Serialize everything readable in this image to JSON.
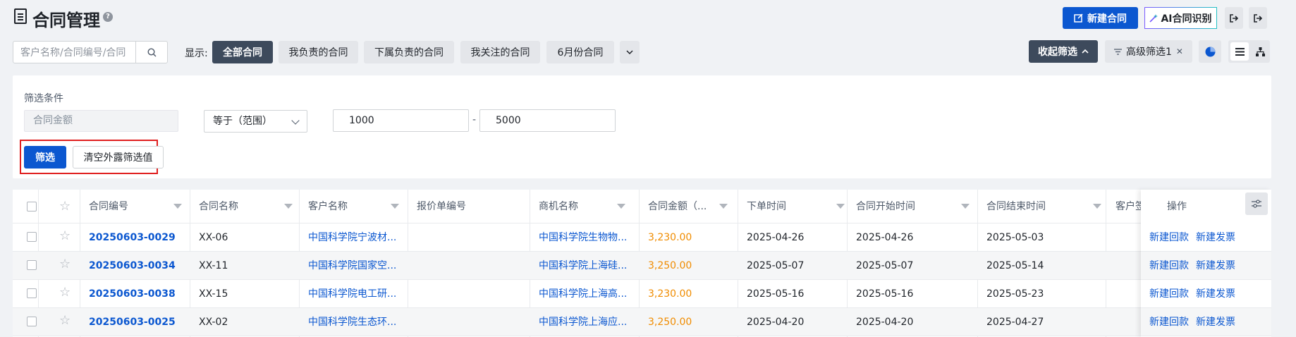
{
  "header": {
    "title": "合同管理",
    "help_glyph": "?",
    "new_contract": "新建合同",
    "ai_recognize": "AI合同识别"
  },
  "toolbar": {
    "search_placeholder": "客户名称/合同编号/合同",
    "show_label": "显示:",
    "views": [
      "全部合同",
      "我负责的合同",
      "下属负责的合同",
      "我关注的合同",
      "6月份合同"
    ],
    "active_view": 0,
    "collapse_filter": "收起筛选",
    "advanced_filter": "高级筛选1"
  },
  "filter": {
    "section_label": "筛选条件",
    "field": "合同金额",
    "operator": "等于（范围）",
    "min": "1000",
    "max": "5000",
    "range_sep": "-",
    "apply": "筛选",
    "clear": "清空外露筛选值"
  },
  "table": {
    "columns": [
      "合同编号",
      "合同名称",
      "客户名称",
      "报价单编号",
      "商机名称",
      "合同金额（...",
      "下单时间",
      "合同开始时间",
      "合同结束时间",
      "客户签"
    ],
    "ops_header": "操作",
    "rows": [
      {
        "id": "20250603-0029",
        "name": "XX-06",
        "customer": "中国科学院宁波材...",
        "quote": "",
        "opportunity": "中国科学院生物物...",
        "amount": "3,230.00",
        "order_date": "2025-04-26",
        "start": "2025-04-26",
        "end": "2025-05-03"
      },
      {
        "id": "20250603-0034",
        "name": "XX-11",
        "customer": "中国科学院国家空...",
        "quote": "",
        "opportunity": "中国科学院上海硅...",
        "amount": "3,250.00",
        "order_date": "2025-05-07",
        "start": "2025-05-07",
        "end": "2025-05-14"
      },
      {
        "id": "20250603-0038",
        "name": "XX-15",
        "customer": "中国科学院电工研...",
        "quote": "",
        "opportunity": "中国科学院上海高...",
        "amount": "3,230.00",
        "order_date": "2025-05-16",
        "start": "2025-05-16",
        "end": "2025-05-23"
      },
      {
        "id": "20250603-0025",
        "name": "XX-02",
        "customer": "中国科学院生态环...",
        "quote": "",
        "opportunity": "中国科学院上海应...",
        "amount": "3,250.00",
        "order_date": "2025-04-20",
        "start": "2025-04-20",
        "end": "2025-04-27"
      }
    ],
    "row_actions": [
      "新建回款",
      "新建发票"
    ]
  },
  "colors": {
    "primary": "#0b57d0",
    "dark": "#3d4a5c",
    "amount": "#f08c00",
    "highlight": "#e02020"
  }
}
